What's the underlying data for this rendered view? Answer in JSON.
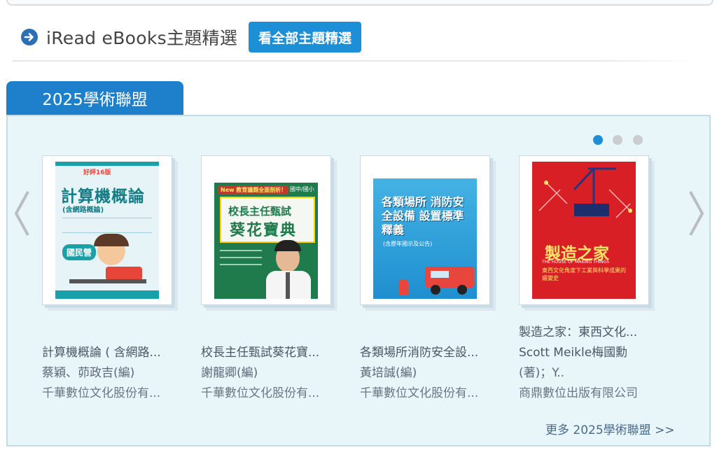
{
  "section": {
    "title": "iRead eBooks主題精選",
    "view_all_label": "看全部主題精選"
  },
  "tab": {
    "label": "2025學術聯盟"
  },
  "carousel": {
    "pages": 3,
    "active_page": 1
  },
  "books": [
    {
      "title": "計算機概論 ( 含網路...",
      "author": "蔡穎、茆政吉(編)",
      "publisher": "千華數位文化股份有...",
      "cover": {
        "badge": "好評16版",
        "title": "計算機概論",
        "subtitle": "(含網路概論)",
        "tag": "國民營",
        "bg": "#e6f4f7",
        "accent": "#1aa0a8"
      }
    },
    {
      "title": "校長主任甄試葵花寶...",
      "author": "謝龍卿(編)",
      "publisher": "千華數位文化股份有...",
      "cover": {
        "title": "校長主任甄試",
        "subtitle": "葵花寶典",
        "tag": "國中/國小",
        "banner": "New 教育議題全面剖析！",
        "bg": "#1f7a4c",
        "accent": "#ffd400"
      }
    },
    {
      "title": "各類場所消防安全設...",
      "author": "黃培誠(編)",
      "publisher": "千華數位文化股份有...",
      "cover": {
        "title": "各類場所 消防安全設備 設置標準釋義",
        "subtitle": "(含歷年國示及公告)",
        "bg": "#2aa9df",
        "accent": "#e8453c"
      }
    },
    {
      "title": "製造之家：東西文化...",
      "author_line1": "Scott Meikle梅國勳",
      "author_line2": "(著)；Y..",
      "publisher": "商鼎數位出版有限公司",
      "cover": {
        "title": "製造之家",
        "subtitle": "東西文化角度下工業與科學成果的嬗變史",
        "en": "THE HOUSE OF MAKING THINGS",
        "bg": "#d91f26",
        "accent": "#ffe36b"
      }
    }
  ],
  "more_link": "更多 2025學術聯盟 >>"
}
